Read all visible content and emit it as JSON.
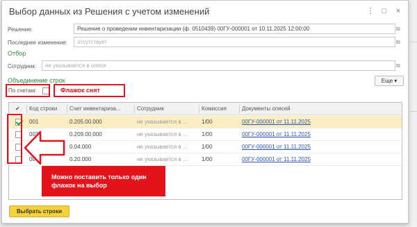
{
  "window": {
    "title": "Выбор данных из Решения с учетом изменений",
    "more_icon": "⋮",
    "maximize_icon": "□",
    "close_icon": "×"
  },
  "fields": {
    "decision_label": "Решение:",
    "decision_value": "Решение о проведении инвентаризации (ф. 0510439) 00ГУ-000001 от 10.11.2025 12:00:00",
    "last_change_label": "Последнее изменение:",
    "last_change_placeholder": "отсутствует",
    "employee_label": "Сотрудник:",
    "employee_placeholder": "не указывается в описи"
  },
  "filter": {
    "title": "Отбор"
  },
  "grouping": {
    "title": "Объединение строк",
    "by_accounts_label": "По счетам:",
    "by_accounts_checked": false,
    "more_button": "Еще ▾"
  },
  "table": {
    "columns": [
      "✔",
      "Код строки",
      "Счет инвентариза...",
      "Сотрудник",
      "Комиссия",
      "Документы описей"
    ],
    "rows": [
      {
        "checked": true,
        "code": "001",
        "account": "0.205.00.000",
        "employee": "не указывается в ...",
        "commission": "1/00",
        "docs": "00ГУ-000001 от 11.11.2025",
        "selected": true
      },
      {
        "checked": false,
        "code": "002",
        "account": "0.209.00.000",
        "employee": "не указывается в ...",
        "commission": "1/00",
        "docs": "00ГУ-000001 от 11.11.2025",
        "selected": false
      },
      {
        "checked": false,
        "code": "003",
        "account": "0.04.000",
        "employee": "не указывается в ...",
        "commission": "1/00",
        "docs": "00ГУ-000001 от 11.11.2025",
        "selected": false
      },
      {
        "checked": false,
        "code": "004",
        "account": "0.20.000",
        "employee": "не указывается в ...",
        "commission": "1/00",
        "docs": "00ГУ-000001 от 11.11.2025",
        "selected": false
      }
    ]
  },
  "footer": {
    "select_rows_button": "Выбрать строки"
  },
  "annotations": {
    "flag_off_label": "Флажок снят",
    "only_one_text": "Можно поставить только один флажок на выбор"
  },
  "colors": {
    "accent_green": "#2c8a3a",
    "annotation_red": "#e0141e",
    "primary_yellow": "#f5d23b",
    "selected_row": "#fbeec3",
    "link_blue": "#2a56b0"
  }
}
